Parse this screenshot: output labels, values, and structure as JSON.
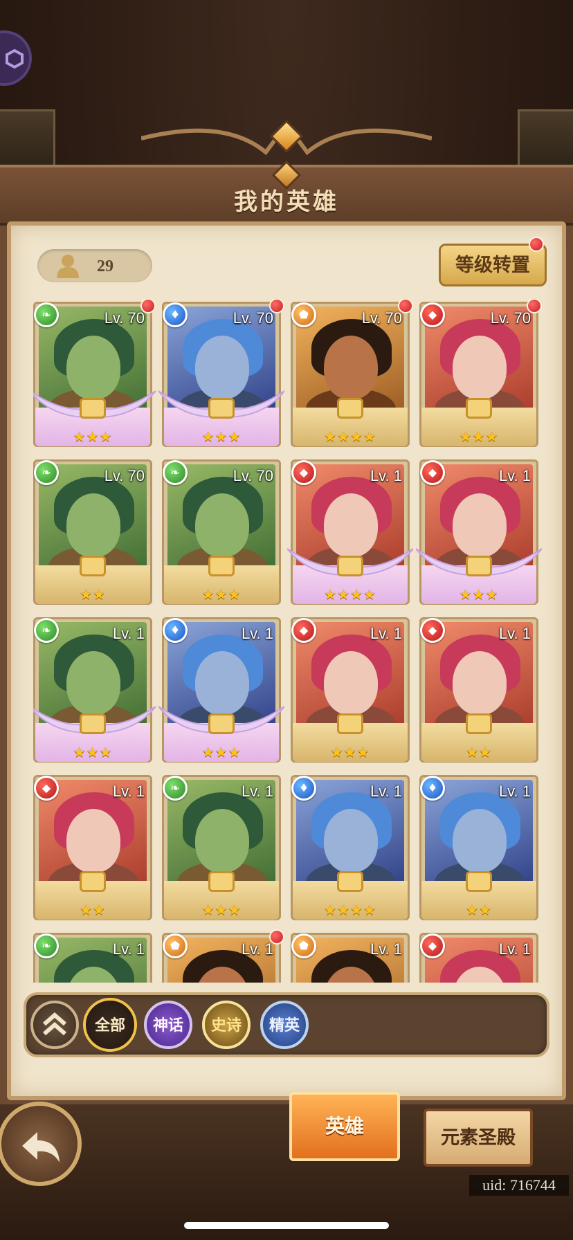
{
  "header": {
    "title": "我的英雄"
  },
  "hero_count": "29",
  "level_transfer_button": "等级转置",
  "heroes": [
    {
      "level": "Lv. 70",
      "element": "nature",
      "stars": "★★★",
      "rarity": "mythic",
      "badge": true,
      "theme": "green"
    },
    {
      "level": "Lv. 70",
      "element": "water",
      "stars": "★★★",
      "rarity": "mythic",
      "badge": true,
      "theme": "blue"
    },
    {
      "level": "Lv. 70",
      "element": "earth",
      "stars": "★★★★",
      "rarity": "epic",
      "badge": true,
      "theme": "orange"
    },
    {
      "level": "Lv. 70",
      "element": "fire",
      "stars": "★★★",
      "rarity": "epic",
      "badge": true,
      "theme": "red"
    },
    {
      "level": "Lv. 70",
      "element": "nature",
      "stars": "★★",
      "rarity": "epic",
      "badge": false,
      "theme": "green"
    },
    {
      "level": "Lv. 70",
      "element": "nature",
      "stars": "★★★",
      "rarity": "epic",
      "badge": false,
      "theme": "green"
    },
    {
      "level": "Lv. 1",
      "element": "fire",
      "stars": "★★★★",
      "rarity": "mythic",
      "badge": false,
      "theme": "red"
    },
    {
      "level": "Lv. 1",
      "element": "fire",
      "stars": "★★★",
      "rarity": "mythic",
      "badge": false,
      "theme": "red"
    },
    {
      "level": "Lv. 1",
      "element": "nature",
      "stars": "★★★",
      "rarity": "mythic",
      "badge": false,
      "theme": "green"
    },
    {
      "level": "Lv. 1",
      "element": "water",
      "stars": "★★★",
      "rarity": "mythic",
      "badge": false,
      "theme": "blue"
    },
    {
      "level": "Lv. 1",
      "element": "fire",
      "stars": "★★★",
      "rarity": "epic",
      "badge": false,
      "theme": "red"
    },
    {
      "level": "Lv. 1",
      "element": "fire",
      "stars": "★★",
      "rarity": "epic",
      "badge": false,
      "theme": "red"
    },
    {
      "level": "Lv. 1",
      "element": "fire",
      "stars": "★★",
      "rarity": "epic",
      "badge": false,
      "theme": "red"
    },
    {
      "level": "Lv. 1",
      "element": "nature",
      "stars": "★★★",
      "rarity": "epic",
      "badge": false,
      "theme": "green"
    },
    {
      "level": "Lv. 1",
      "element": "water",
      "stars": "★★★★",
      "rarity": "epic",
      "badge": false,
      "theme": "blue"
    },
    {
      "level": "Lv. 1",
      "element": "water",
      "stars": "★★",
      "rarity": "epic",
      "badge": false,
      "theme": "blue"
    },
    {
      "level": "Lv. 1",
      "element": "nature",
      "stars": "",
      "rarity": "epic",
      "badge": false,
      "theme": "green"
    },
    {
      "level": "Lv. 1",
      "element": "earth",
      "stars": "",
      "rarity": "epic",
      "badge": true,
      "theme": "orange"
    },
    {
      "level": "Lv. 1",
      "element": "earth",
      "stars": "",
      "rarity": "epic",
      "badge": false,
      "theme": "orange"
    },
    {
      "level": "Lv. 1",
      "element": "fire",
      "stars": "",
      "rarity": "epic",
      "badge": false,
      "theme": "red"
    }
  ],
  "filters": {
    "all": "全部",
    "mythic": "神话",
    "epic": "史诗",
    "elite": "精英"
  },
  "tabs": {
    "heroes": "英雄",
    "temple": "元素圣殿"
  },
  "uid": "uid: 716744",
  "icons": {
    "count": "person-icon",
    "back": "back-arrow-icon",
    "collapse": "chevron-up-double-icon",
    "menu": "hexagon-icon"
  },
  "colors": {
    "accent": "#e2701e",
    "panel": "#f0e5cc",
    "frame": "#6d4a32"
  }
}
